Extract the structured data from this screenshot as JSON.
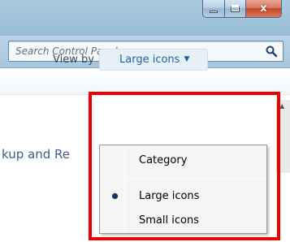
{
  "window": {
    "controls": {
      "minimize_icon": "minimize-icon",
      "maximize_icon": "maximize-icon",
      "close_icon": "close-icon",
      "close_glyph": "x"
    }
  },
  "search": {
    "placeholder": "Search Control Panel",
    "value": "",
    "icon": "magnifier-icon"
  },
  "view_by": {
    "label": "View by",
    "selected": "Large icons",
    "arrow": "▼"
  },
  "dropdown": {
    "options": [
      {
        "label": "Category",
        "selected": false
      },
      {
        "label": "Large icons",
        "selected": true
      },
      {
        "label": "Small icons",
        "selected": false
      }
    ]
  },
  "content": {
    "partial_link_text": "kup and Re"
  },
  "colors": {
    "highlight": "#ee0000",
    "link": "#1f62a9",
    "title_gradient_top": "#a9c9df",
    "menu_bg": "#f5f5f5"
  }
}
